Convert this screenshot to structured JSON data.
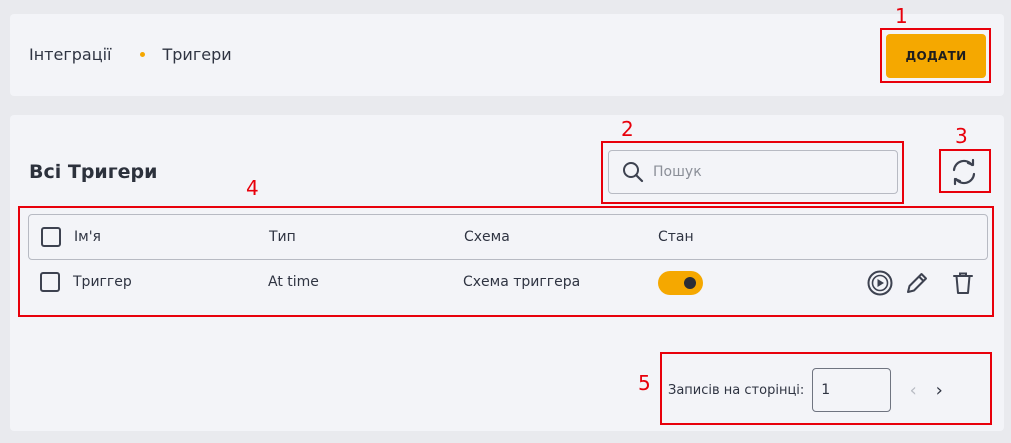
{
  "breadcrumb": {
    "parent": "Інтеграції",
    "current": "Тригери"
  },
  "header": {
    "add_label": "ДОДАТИ"
  },
  "main": {
    "title": "Всі Тригери",
    "search": {
      "placeholder": "Пошук",
      "value": ""
    }
  },
  "table": {
    "columns": [
      "Ім'я",
      "Тип",
      "Схема",
      "Стан"
    ],
    "rows": [
      {
        "name": "Триггер",
        "type": "At time",
        "scheme": "Схема триггера",
        "enabled": true
      }
    ]
  },
  "pagination": {
    "label": "Записів на сторінці:",
    "per_page": "1",
    "prev": "‹",
    "next": "›"
  },
  "annotations": [
    "1",
    "2",
    "3",
    "4",
    "5"
  ],
  "colors": {
    "accent": "#f5a800",
    "highlight": "#e8000b"
  }
}
